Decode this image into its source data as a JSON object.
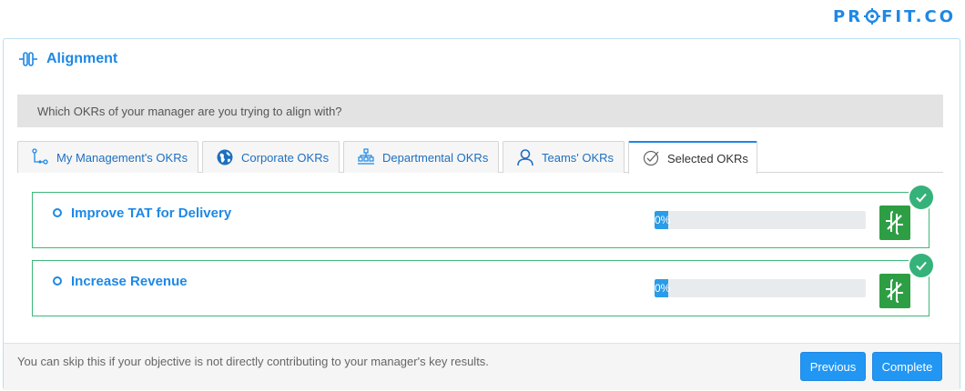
{
  "brand": {
    "name": "PROFIT.CO",
    "before_o": "PR",
    "after_o": "FIT.CO"
  },
  "colors": {
    "accent": "#1e88e5",
    "success": "#35b27a",
    "align_button": "#2e9e44",
    "okr_border": "#3cb878"
  },
  "header": {
    "title": "Alignment",
    "icon": "alignment-icon"
  },
  "question": "Which OKRs of your manager are you trying to align with?",
  "tabs": [
    {
      "label": "My Management's OKRs",
      "icon": "hierarchy-nodes-icon"
    },
    {
      "label": "Corporate OKRs",
      "icon": "globe-icon"
    },
    {
      "label": "Departmental OKRs",
      "icon": "org-chart-icon"
    },
    {
      "label": "Teams' OKRs",
      "icon": "user-icon"
    },
    {
      "label": "Selected OKRs",
      "icon": "check-circle-icon",
      "active": true
    }
  ],
  "okrs": [
    {
      "title": "Improve TAT for Delivery",
      "progress_label": "0%",
      "progress": 0,
      "selected": true
    },
    {
      "title": "Increase Revenue",
      "progress_label": "0%",
      "progress": 0,
      "selected": true
    }
  ],
  "footer": {
    "note": "You can skip this if your objective is not directly contributing to your manager's key results.",
    "previous_label": "Previous",
    "complete_label": "Complete"
  }
}
